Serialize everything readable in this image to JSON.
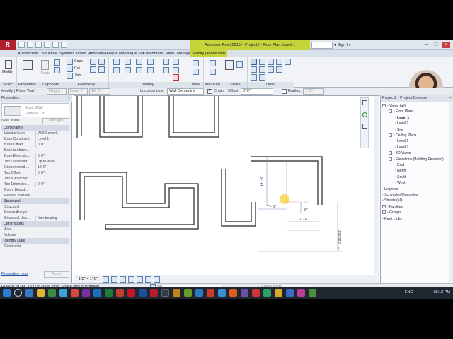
{
  "titlebar": {
    "app_title": "Autodesk Revit 2013 -",
    "doc_title": "Project2 - Floor Plan: Level 1",
    "search": "Type a keyword or phrase",
    "sign_in": "Sign In"
  },
  "tabs": [
    "Architecture",
    "Structure",
    "Systems",
    "Insert",
    "Annotate",
    "Analyze",
    "Massing & Site",
    "Collaborate",
    "View",
    "Manage",
    "Modify | Place Wall"
  ],
  "ribbon": {
    "modify": "Modify",
    "select": "Select",
    "properties_btn": "Properties",
    "properties": "Properties",
    "clipboard": "Clipboard",
    "paste": "Paste",
    "geometry": "Geometry",
    "modify_panel": "Modify",
    "view": "View",
    "measure": "Measure",
    "create": "Create",
    "draw": "Draw",
    "cope": "Cope",
    "cut": "Cut",
    "join": "Join"
  },
  "options": {
    "context": "Modify | Place Wall",
    "height": "Height",
    "level": "Level 2",
    "height_val": "10' 0\"",
    "location_line_label": "Location Line:",
    "location_line": "Wall Centerline",
    "chain": "Chain",
    "offset_label": "Offset:",
    "offset": "5' 0\"",
    "radius": "Radius:",
    "radius_val": "1' 0\""
  },
  "props": {
    "header": "Properties",
    "family": "Basic Wall",
    "type": "Generic - 8\"",
    "new": "New Walls",
    "edit_type": "Edit Type",
    "sections": [
      {
        "title": "Constraints",
        "rows": [
          [
            "Location Line",
            "Wall Centerl..."
          ],
          [
            "Base Constraint",
            "Level 1"
          ],
          [
            "Base Offset",
            "0' 0\""
          ],
          [
            "Base is Attach...",
            ""
          ],
          [
            "Base Extensio...",
            "0' 0\""
          ],
          [
            "Top Constraint",
            "Up to level: ..."
          ],
          [
            "Unconnected ...",
            "10' 0\""
          ],
          [
            "Top Offset",
            "0' 0\""
          ],
          [
            "Top is Attached",
            ""
          ],
          [
            "Top Extension...",
            "0' 0\""
          ],
          [
            "Room Boundi...",
            ""
          ],
          [
            "Related to Mass",
            ""
          ]
        ]
      },
      {
        "title": "Structural",
        "rows": [
          [
            "Structural",
            ""
          ],
          [
            "Enable Analyti...",
            ""
          ],
          [
            "Structural Usa...",
            "Non-bearing"
          ]
        ]
      },
      {
        "title": "Dimensions",
        "rows": [
          [
            "Area",
            ""
          ],
          [
            "Volume",
            ""
          ]
        ]
      },
      {
        "title": "Identity Data",
        "rows": [
          [
            "Comments",
            ""
          ]
        ]
      }
    ],
    "help": "Properties help",
    "apply": "Apply"
  },
  "browser": {
    "header": "Project2 - Project Browser",
    "items": [
      {
        "label": "Views (all)",
        "indent": 0,
        "toggle": "-"
      },
      {
        "label": "Floor Plans",
        "indent": 1,
        "toggle": "-"
      },
      {
        "label": "Level 1",
        "indent": 2,
        "toggle": "",
        "bold": true
      },
      {
        "label": "Level 2",
        "indent": 2,
        "toggle": ""
      },
      {
        "label": "Site",
        "indent": 2,
        "toggle": ""
      },
      {
        "label": "Ceiling Plans",
        "indent": 1,
        "toggle": "-"
      },
      {
        "label": "Level 1",
        "indent": 2,
        "toggle": ""
      },
      {
        "label": "Level 2",
        "indent": 2,
        "toggle": ""
      },
      {
        "label": "3D Views",
        "indent": 1,
        "toggle": "+"
      },
      {
        "label": "Elevations (Building Elevation)",
        "indent": 1,
        "toggle": "-"
      },
      {
        "label": "East",
        "indent": 2,
        "toggle": ""
      },
      {
        "label": "North",
        "indent": 2,
        "toggle": ""
      },
      {
        "label": "South",
        "indent": 2,
        "toggle": ""
      },
      {
        "label": "West",
        "indent": 2,
        "toggle": ""
      },
      {
        "label": "Legends",
        "indent": 0,
        "toggle": ""
      },
      {
        "label": "Schedules/Quantities",
        "indent": 0,
        "toggle": ""
      },
      {
        "label": "Sheets (all)",
        "indent": 0,
        "toggle": ""
      },
      {
        "label": "Families",
        "indent": 0,
        "toggle": "+"
      },
      {
        "label": "Groups",
        "indent": 0,
        "toggle": "+"
      },
      {
        "label": "Revit Links",
        "indent": 0,
        "toggle": ""
      }
    ]
  },
  "canvas": {
    "dim1": "14' - 6\"",
    "dim2": "7' - 6\"",
    "dim3": "7' - 6\"",
    "dim4": "6\"",
    "dim5": "7' - 2 35/256\"",
    "scale": "1/8\" = 1'-0\""
  },
  "status": {
    "text": "HORIZONTAL. (SZ) to close loop. Space flips orientation.",
    "model": "Main Model",
    "zero": ":0"
  },
  "taskbar": {
    "lang": "ENG",
    "time": "08:12 PM"
  }
}
